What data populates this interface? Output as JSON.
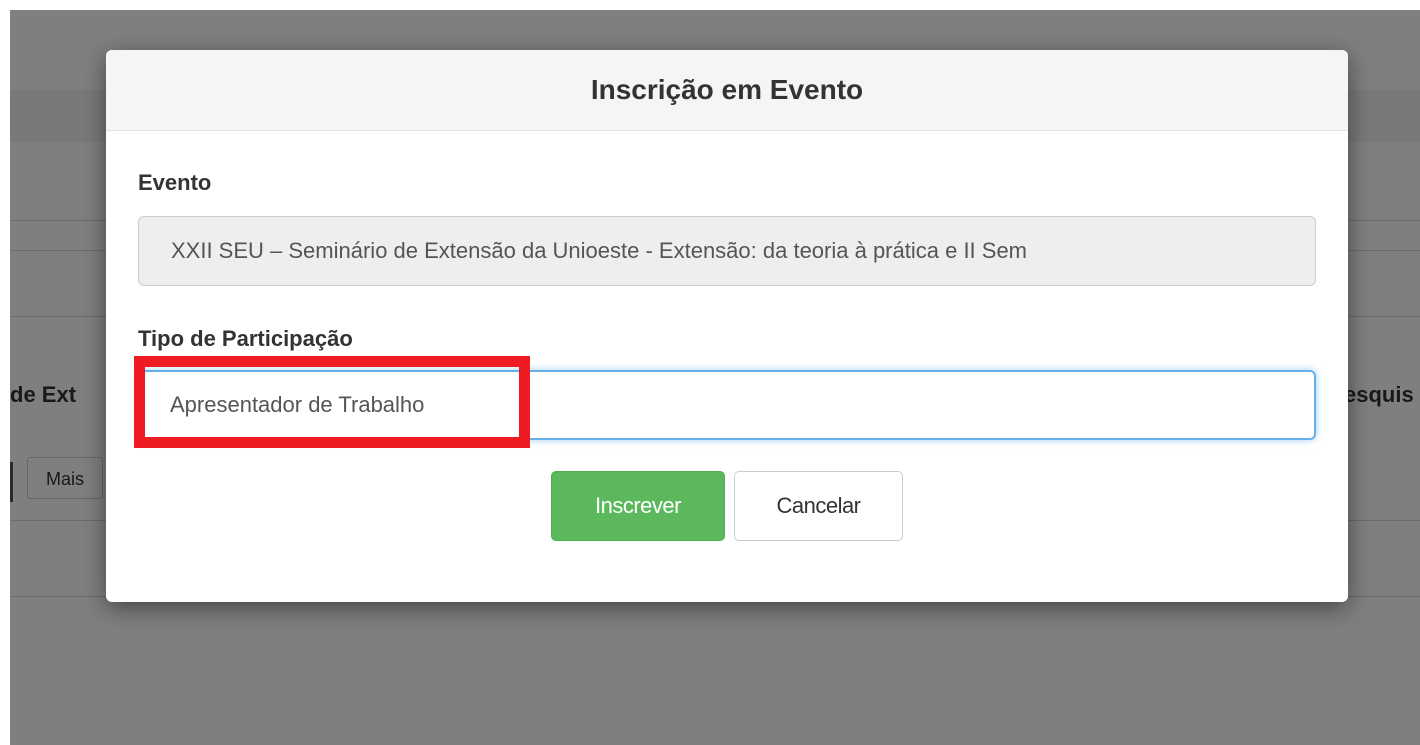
{
  "background": {
    "left_text": "de Ext",
    "right_text": "esquis",
    "more_button": "Mais"
  },
  "modal": {
    "title": "Inscrição em Evento",
    "evento": {
      "label": "Evento",
      "value": "XXII SEU – Seminário de Extensão da Unioeste - Extensão: da teoria à prática e II Sem"
    },
    "tipo_participacao": {
      "label": "Tipo de Participação",
      "value": "Apresentador de Trabalho"
    },
    "buttons": {
      "submit": "Inscrever",
      "cancel": "Cancelar"
    }
  },
  "colors": {
    "primary_action": "#5cb85c",
    "focus_border": "#66afe9",
    "highlight_annotation": "#ee1b23"
  }
}
